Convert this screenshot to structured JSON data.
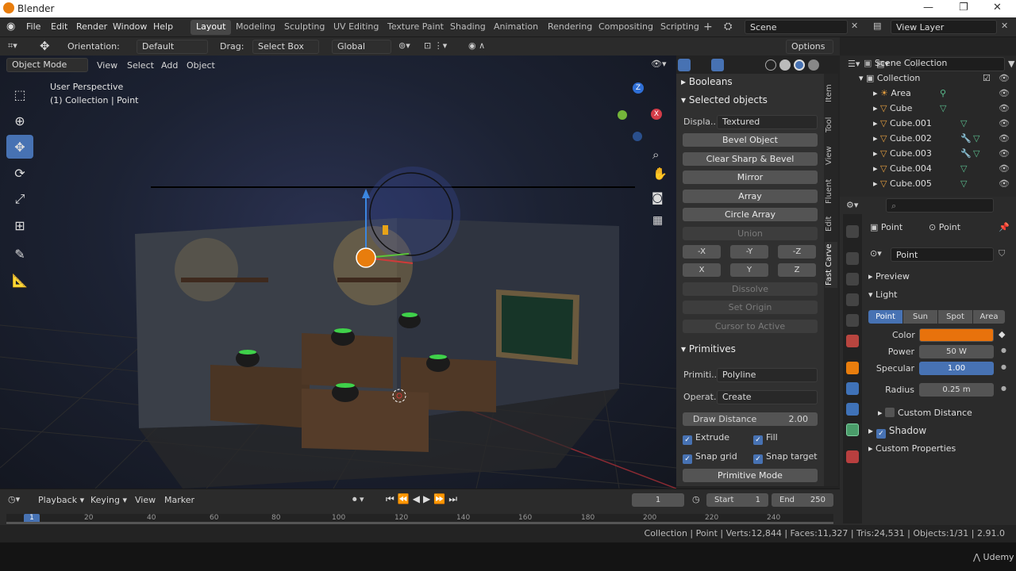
{
  "window": {
    "title": "Blender",
    "controls": [
      "—",
      "❐",
      "✕"
    ]
  },
  "menu": [
    "File",
    "Edit",
    "Render",
    "Window",
    "Help"
  ],
  "workspaces": [
    "Layout",
    "Modeling",
    "Sculpting",
    "UV Editing",
    "Texture Paint",
    "Shading",
    "Animation",
    "Rendering",
    "Compositing",
    "Scripting"
  ],
  "active_workspace": "Layout",
  "scene": {
    "label": "Scene"
  },
  "view_layer": {
    "label": "View Layer"
  },
  "toolbar": {
    "orientation_label": "Orientation:",
    "orientation_value": "Default",
    "drag_label": "Drag:",
    "drag_value": "Select Box",
    "transform_orientation": "Global",
    "options_label": "Options"
  },
  "viewport_header": {
    "mode": "Object Mode",
    "items": [
      "View",
      "Select",
      "Add",
      "Object"
    ]
  },
  "viewport": {
    "perspective": "User Perspective",
    "collection_info": "(1) Collection | Point"
  },
  "gizmo": {
    "z": "Z",
    "x": "X",
    "y": "Y"
  },
  "npanel": {
    "booleans": "Booleans",
    "selected_objects": "Selected objects",
    "display_label": "Displa...",
    "display_value": "Textured",
    "buttons": [
      "Bevel Object",
      "Clear Sharp & Bevel",
      "Mirror",
      "Array",
      "Circle Array",
      "Union"
    ],
    "axis_row1": [
      "-X",
      "-Y",
      "-Z"
    ],
    "axis_row2": [
      "X",
      "Y",
      "Z"
    ],
    "disabled_buttons": [
      "Dissolve",
      "Set Origin",
      "Cursor to Active"
    ],
    "primitives": "Primitives",
    "primitive_label": "Primiti...",
    "primitive_value": "Polyline",
    "operation_label": "Operat...",
    "operation_value": "Create",
    "draw_distance_label": "Draw Distance",
    "draw_distance_value": "2.00",
    "extrude": "Extrude",
    "fill": "Fill",
    "snap_grid": "Snap grid",
    "snap_target": "Snap target",
    "primitive_mode": "Primitive Mode",
    "tabs": [
      "Item",
      "Tool",
      "View",
      "Fluent",
      "Edit",
      "Fast Carve"
    ]
  },
  "outliner": {
    "root": "Scene Collection",
    "collection": "Collection",
    "items": [
      "Area",
      "Cube",
      "Cube.001",
      "Cube.002",
      "Cube.003",
      "Cube.004",
      "Cube.005"
    ]
  },
  "properties": {
    "object_name": "Point",
    "data_name": "Point",
    "light_name": "Point",
    "preview": "Preview",
    "light": "Light",
    "light_types": [
      "Point",
      "Sun",
      "Spot",
      "Area"
    ],
    "active_light_type": "Point",
    "color_label": "Color",
    "color_value": "#e8720c",
    "power_label": "Power",
    "power_value": "50 W",
    "specular_label": "Specular",
    "specular_value": "1.00",
    "radius_label": "Radius",
    "radius_value": "0.25 m",
    "custom_distance": "Custom Distance",
    "shadow": "Shadow",
    "custom_properties": "Custom Properties"
  },
  "timeline": {
    "playback": "Playback",
    "keying": "Keying",
    "view": "View",
    "marker": "Marker",
    "current_frame": "1",
    "start_label": "Start",
    "start_value": "1",
    "end_label": "End",
    "end_value": "250",
    "ruler": [
      "1",
      "20",
      "40",
      "60",
      "80",
      "100",
      "120",
      "140",
      "160",
      "180",
      "200",
      "220",
      "240"
    ]
  },
  "status": "Collection | Point | Verts:12,844 | Faces:11,327 | Tris:24,531 | Objects:1/31 | 2.91.0",
  "watermark": "Udemy",
  "colors": {
    "accent": "#4772b3",
    "orange": "#e87d0d",
    "light_color": "#e8720c"
  }
}
